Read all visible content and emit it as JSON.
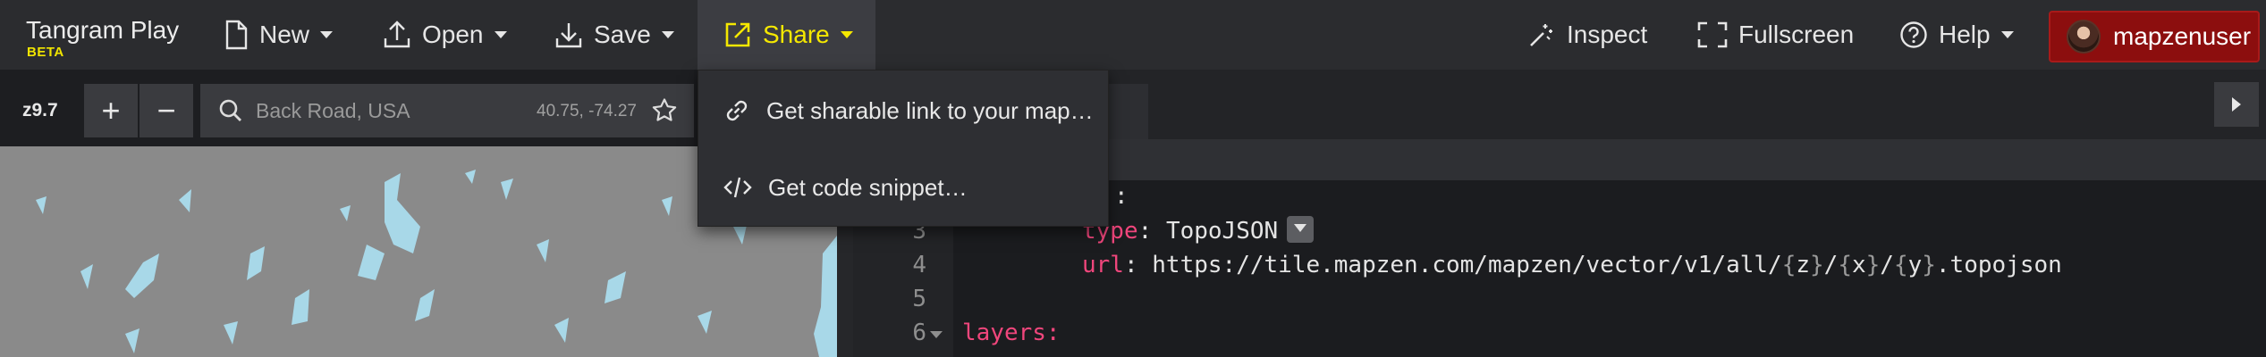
{
  "brand": {
    "title": "Tangram Play",
    "badge": "BETA"
  },
  "menu": {
    "new_label": "New",
    "open_label": "Open",
    "save_label": "Save",
    "share_label": "Share",
    "inspect_label": "Inspect",
    "fullscreen_label": "Fullscreen",
    "help_label": "Help",
    "user_label": "mapzenuser"
  },
  "share_dropdown": {
    "items": [
      {
        "label": "Get sharable link to your map…",
        "icon": "link-icon"
      },
      {
        "label": "Get code snippet…",
        "icon": "code-icon"
      }
    ]
  },
  "map": {
    "zoom_level": "z9.7",
    "zoom_in": "+",
    "zoom_out": "−",
    "search_placeholder": "Back Road, USA",
    "coordinates": "40.75, -74.27"
  },
  "editor": {
    "line_numbers": [
      "3",
      "4",
      "5",
      "6"
    ],
    "fragment_colon": ":",
    "line3_key": "type",
    "line3_value": "TopoJSON",
    "line4_key": "url",
    "line4_prefix": "https://tile.mapzen.com/mapzen/vector/v1/all/",
    "line4_z": "z",
    "line4_x": "x",
    "line4_y": "y",
    "line4_suffix": ".topojson",
    "line6_key": "layers"
  },
  "colors": {
    "accent": "#f5e800",
    "user_button": "#8c0e0e",
    "yaml_key": "#f0467c",
    "water": "#a8d8e8",
    "land": "#8a8a8a"
  }
}
